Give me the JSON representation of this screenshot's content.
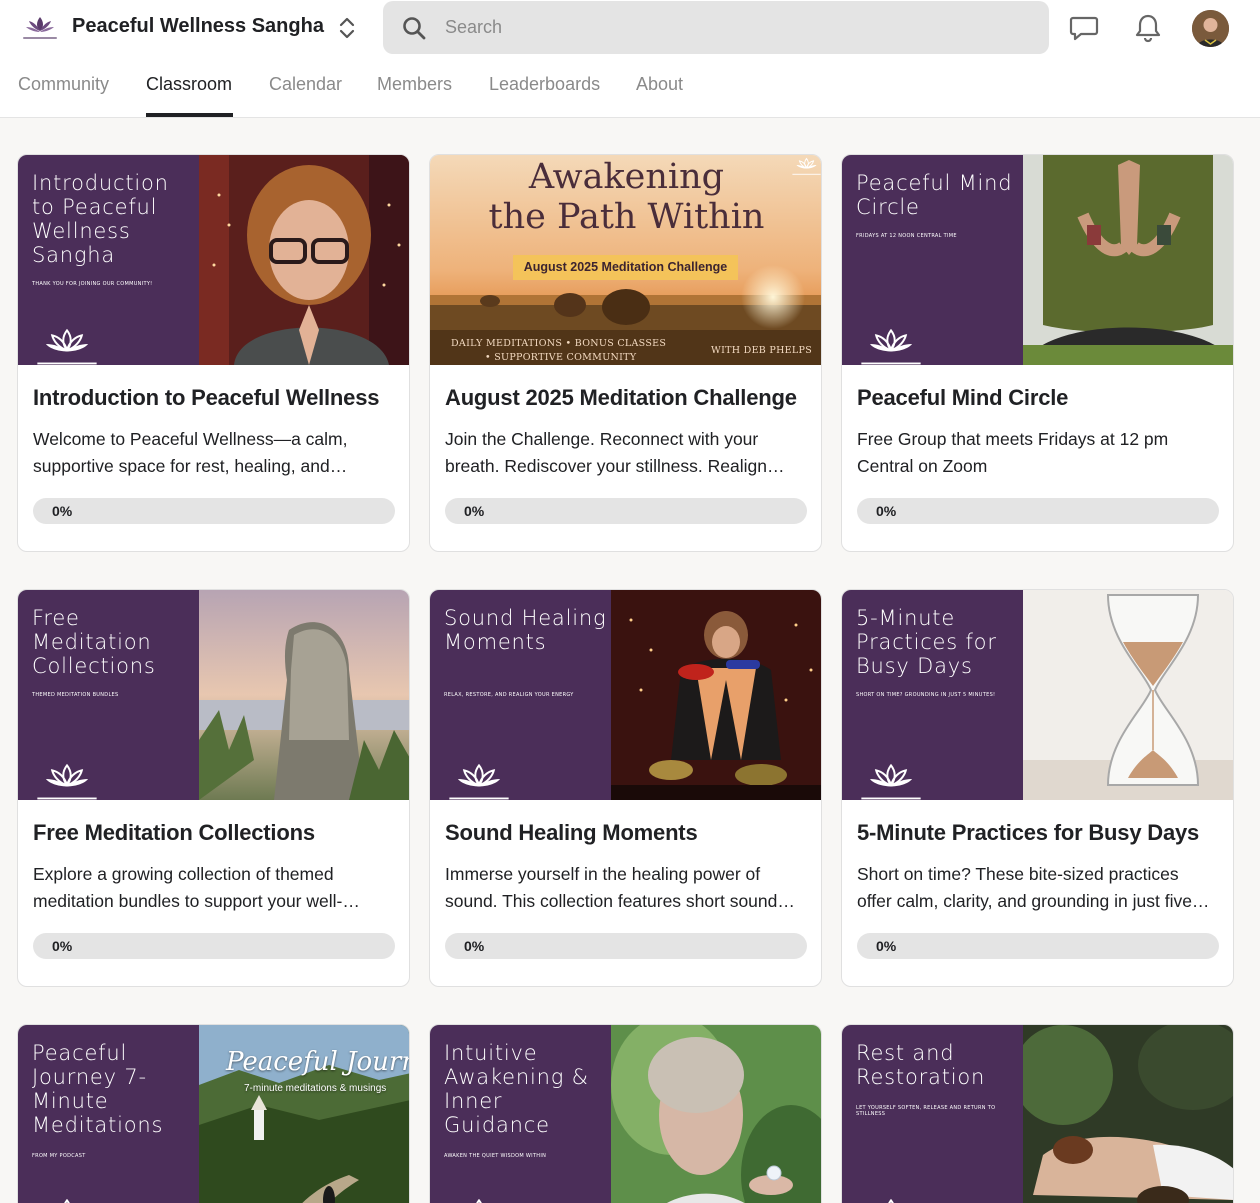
{
  "header": {
    "brand_name": "Peaceful Wellness Sangha",
    "search_placeholder": "Search"
  },
  "tabs": [
    {
      "label": "Community",
      "active": false
    },
    {
      "label": "Classroom",
      "active": true
    },
    {
      "label": "Calendar",
      "active": false
    },
    {
      "label": "Members",
      "active": false
    },
    {
      "label": "Leaderboards",
      "active": false
    },
    {
      "label": "About",
      "active": false
    }
  ],
  "colors": {
    "accent": "#4b2e59",
    "progress_track": "#e4e4e4",
    "page_bg": "#f8f7f5"
  },
  "courses": [
    {
      "cover_title": "Introduction to Peaceful Wellness Sangha",
      "cover_subtitle": "THANK YOU FOR JOINING OUR COMMUNITY!",
      "title": "Introduction to Peaceful Wellness",
      "desc_line1": "Welcome to Peaceful Wellness—a calm,",
      "desc_line2": "supportive space for rest, healing, and…",
      "progress_label": "0%",
      "progress": 0
    },
    {
      "cover_line1": "Awakening",
      "cover_line2": "the Path Within",
      "cover_badge": "August 2025 Meditation Challenge",
      "cover_footer_left1": "DAILY MEDITATIONS • BONUS CLASSES",
      "cover_footer_left2": "• SUPPORTIVE COMMUNITY",
      "cover_footer_right": "WITH DEB PHELPS",
      "title": "August 2025 Meditation Challenge",
      "desc_line1": "Join the Challenge. Reconnect with your",
      "desc_line2": "breath. Rediscover your stillness. Realign…",
      "progress_label": "0%",
      "progress": 0
    },
    {
      "cover_title": "Peaceful Mind Circle",
      "cover_subtitle": "FRIDAYS AT 12 NOON CENTRAL TIME",
      "title": "Peaceful Mind Circle",
      "desc_line1": "Free Group that meets Fridays at 12 pm",
      "desc_line2": "Central on Zoom",
      "progress_label": "0%",
      "progress": 0
    },
    {
      "cover_title": "Free Meditation Collections",
      "cover_subtitle": "THEMED MEDITATION BUNDLES",
      "title": "Free Meditation Collections",
      "desc_line1": "Explore a growing collection of themed",
      "desc_line2": "meditation bundles to support your well-…",
      "progress_label": "0%",
      "progress": 0
    },
    {
      "cover_title": "Sound Healing Moments",
      "cover_subtitle": "RELAX, RESTORE, AND REALIGN YOUR ENERGY",
      "title": "Sound Healing Moments",
      "desc_line1": "Immerse yourself in the healing power of",
      "desc_line2": "sound. This collection features short sound…",
      "progress_label": "0%",
      "progress": 0
    },
    {
      "cover_title": "5-Minute Practices for Busy Days",
      "cover_subtitle": "SHORT ON TIME? GROUNDING IN JUST 5 MINUTES!",
      "title": "5-Minute Practices for Busy Days",
      "desc_line1": "Short on time? These bite-sized practices",
      "desc_line2": "offer calm, clarity, and grounding in just five…",
      "progress_label": "0%",
      "progress": 0
    },
    {
      "cover_title": "Peaceful Journey 7-Minute Meditations",
      "cover_subtitle": "FROM MY PODCAST",
      "cover_script": "Peaceful Journey",
      "cover_script_sub": "7-minute meditations & musings"
    },
    {
      "cover_title": "Intuitive Awakening & Inner Guidance",
      "cover_subtitle": "AWAKEN THE QUIET WISDOM WITHIN"
    },
    {
      "cover_title": "Rest and Restoration",
      "cover_subtitle": "LET YOURSELF SOFTEN, RELEASE AND RETURN TO STILLNESS"
    }
  ]
}
